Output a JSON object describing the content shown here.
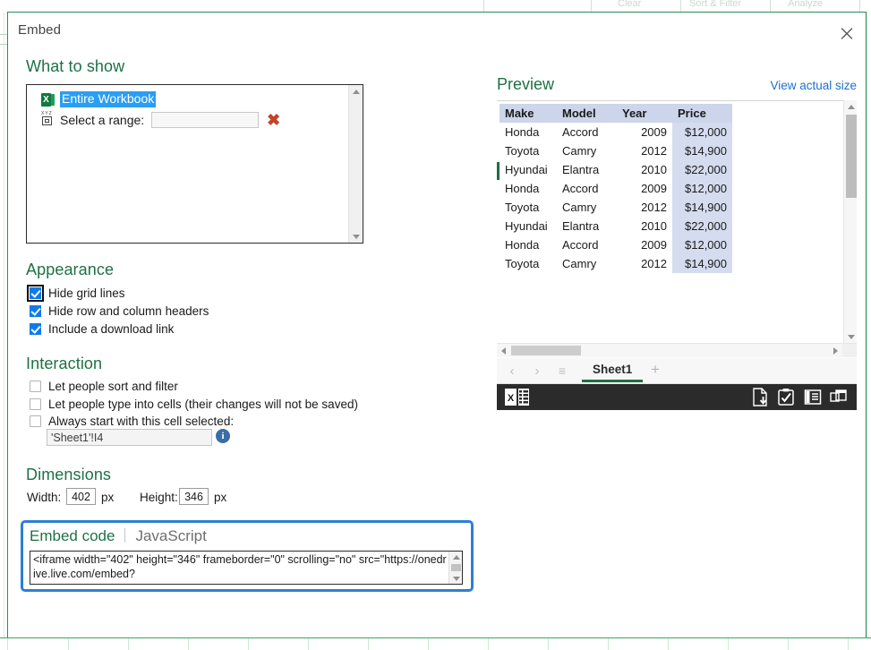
{
  "background": {
    "ribbon_fragments": [
      "Clear",
      "Sort & Filter",
      "Analyze"
    ]
  },
  "dialog": {
    "title": "Embed",
    "close_icon": "close-icon"
  },
  "what_to_show": {
    "heading": "What to show",
    "entire_workbook_label": "Entire Workbook",
    "entire_workbook_icon": "excel-workbook-icon",
    "select_range_label": "Select a range:",
    "select_range_icon": "range-select-icon",
    "range_value": "",
    "range_placeholder": "",
    "delete_icon": "red-x-delete-icon"
  },
  "appearance": {
    "heading": "Appearance",
    "options": [
      {
        "label": "Hide grid lines",
        "checked": true,
        "focused": true
      },
      {
        "label": "Hide row and column headers",
        "checked": true,
        "focused": false
      },
      {
        "label": "Include a download link",
        "checked": true,
        "focused": false
      }
    ]
  },
  "interaction": {
    "heading": "Interaction",
    "options": [
      {
        "label": "Let people sort and filter",
        "checked": false
      },
      {
        "label": "Let people type into cells (their changes will not be saved)",
        "checked": false
      },
      {
        "label": "Always start with this cell selected:",
        "checked": false
      }
    ],
    "cell_reference_value": "'Sheet1'!I4",
    "info_icon": "info-icon",
    "info_glyph": "i"
  },
  "dimensions": {
    "heading": "Dimensions",
    "width_label": "Width:",
    "width_value": "402",
    "width_unit": "px",
    "height_label": "Height:",
    "height_value": "346",
    "height_unit": "px"
  },
  "embed_code": {
    "tab_embed": "Embed code",
    "tab_javascript": "JavaScript",
    "code": "<iframe width=\"402\" height=\"346\" frameborder=\"0\" scrolling=\"no\" src=\"https://onedrive.live.com/embed?",
    "scroll_up_icon": "chevron-up-icon",
    "scroll_down_icon": "chevron-down-icon"
  },
  "preview": {
    "heading": "Preview",
    "view_actual_size_link": "View actual size",
    "table": {
      "columns": [
        "Make",
        "Model",
        "Year",
        "Price"
      ],
      "rows": [
        [
          "Honda",
          "Accord",
          "2009",
          "$12,000"
        ],
        [
          "Toyota",
          "Camry",
          "2012",
          "$14,900"
        ],
        [
          "Hyundai",
          "Elantra",
          "2010",
          "$22,000"
        ],
        [
          "Honda",
          "Accord",
          "2009",
          "$12,000"
        ],
        [
          "Toyota",
          "Camry",
          "2012",
          "$14,900"
        ],
        [
          "Hyundai",
          "Elantra",
          "2010",
          "$22,000"
        ],
        [
          "Honda",
          "Accord",
          "2009",
          "$12,000"
        ],
        [
          "Toyota",
          "Camry",
          "2012",
          "$14,900"
        ]
      ]
    },
    "sheet_tab": "Sheet1",
    "add_sheet_glyph": "+",
    "nav_prev_glyph": "‹",
    "nav_next_glyph": "›",
    "nav_menu_glyph": "≡",
    "status_icons": [
      "excel-logo-icon",
      "download-icon",
      "edit-in-browser-icon",
      "reading-view-icon",
      "open-in-new-window-icon"
    ]
  },
  "colors": {
    "heading_green": "#1e7145",
    "link_blue": "#1f6fd0",
    "accent_blue": "#2d7fd3",
    "checkbox_blue": "#0f7bea",
    "selection_blue": "#2a9df4",
    "table_header_blue": "#ccd5ea",
    "table_price_blue": "#d5dcef",
    "dark_bar": "#2b2b2b",
    "excel_green": "#1d7044",
    "delete_red": "#c0462a"
  }
}
